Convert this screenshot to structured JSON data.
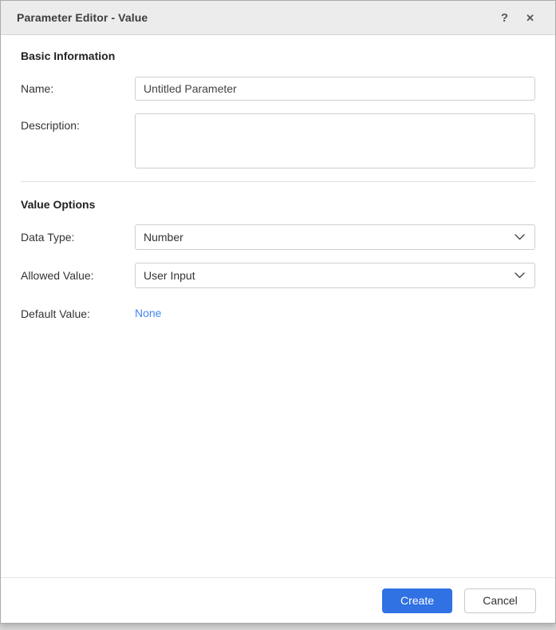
{
  "dialog": {
    "title": "Parameter Editor - Value",
    "header": {
      "help_icon": "?",
      "close_icon": "✕"
    }
  },
  "sections": {
    "basic_information": {
      "title": "Basic Information"
    },
    "value_options": {
      "title": "Value Options"
    }
  },
  "fields": {
    "name": {
      "label": "Name:",
      "value": "Untitled Parameter"
    },
    "description": {
      "label": "Description:",
      "value": ""
    },
    "data_type": {
      "label": "Data Type:",
      "value": "Number"
    },
    "allowed_value": {
      "label": "Allowed Value:",
      "value": "User Input"
    },
    "default_value": {
      "label": "Default Value:",
      "value": "None"
    }
  },
  "footer": {
    "create_label": "Create",
    "cancel_label": "Cancel"
  },
  "colors": {
    "primary_button": "#3071e3",
    "link": "#4285f4",
    "header_bg": "#ececec"
  }
}
